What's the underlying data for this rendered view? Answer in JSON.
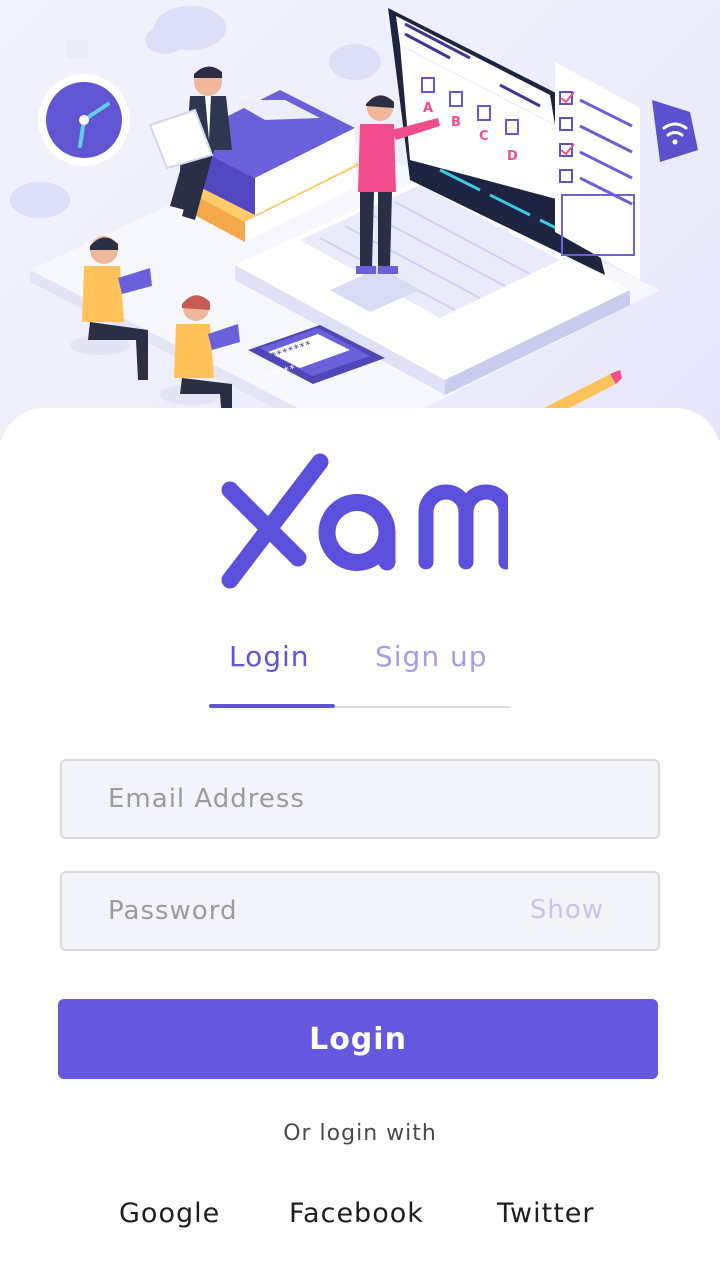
{
  "brand": {
    "name": "Xam",
    "accent_color": "#6657e0"
  },
  "tabs": [
    {
      "label": "Login",
      "active": true
    },
    {
      "label": "Sign up",
      "active": false
    }
  ],
  "form": {
    "email": {
      "placeholder": "Email Address",
      "value": ""
    },
    "password": {
      "placeholder": "Password",
      "value": "",
      "toggle_label": "Show"
    },
    "submit_label": "Login"
  },
  "social": {
    "prompt": "Or login with",
    "providers": [
      "Google",
      "Facebook",
      "Twitter"
    ]
  },
  "illustration": {
    "choice_letters": [
      "A",
      "B",
      "C",
      "D"
    ],
    "password_masks": [
      "*******",
      "*******"
    ],
    "icons": [
      "stopwatch-icon",
      "wifi-icon",
      "books-icon",
      "laptop-icon",
      "pencil-icon"
    ]
  }
}
